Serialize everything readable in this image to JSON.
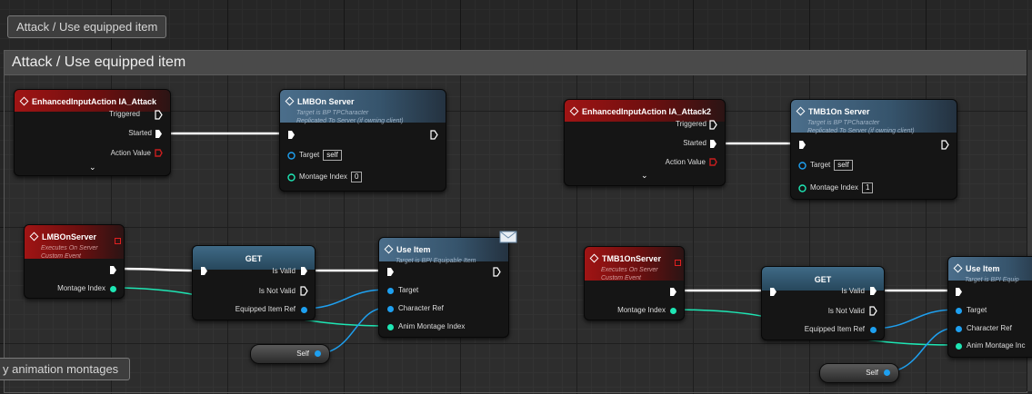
{
  "comment": {
    "tag_label": "Attack / Use equipped item",
    "title": "Attack / Use equipped item",
    "lower_tag_label": "y animation montages"
  },
  "nodes": {
    "ia_attack": {
      "title": "EnhancedInputAction IA_Attack",
      "pins": [
        "Triggered",
        "Started",
        "Action Value"
      ]
    },
    "lmb_on_server_call": {
      "title": "LMBOn Server",
      "sub1": "Target is BP TPCharacter",
      "sub2": "Replicated To Server (if owning client)",
      "target_label": "Target",
      "target_default": "self",
      "montage_label": "Montage Index",
      "montage_default": "0"
    },
    "ia_attack2": {
      "title": "EnhancedInputAction IA_Attack2",
      "pins": [
        "Triggered",
        "Started",
        "Action Value"
      ]
    },
    "tmb1_on_server_call": {
      "title": "TMB1On Server",
      "sub1": "Target is BP TPCharacter",
      "sub2": "Replicated To Server (if owning client)",
      "target_label": "Target",
      "target_default": "self",
      "montage_label": "Montage Index",
      "montage_default": "1"
    },
    "lmb_on_server_event": {
      "title": "LMBOnServer",
      "sub1": "Executes On Server",
      "sub2": "Custom Event",
      "pin": "Montage Index"
    },
    "get1": {
      "title": "GET",
      "pins": [
        "Is Valid",
        "Is Not Valid",
        "Equipped Item Ref"
      ]
    },
    "use_item1": {
      "title": "Use Item",
      "sub1": "Target is BPI Equipable Item",
      "pins": [
        "Target",
        "Character Ref",
        "Anim Montage Index"
      ]
    },
    "self1": {
      "label": "Self"
    },
    "tmb1_on_server_event": {
      "title": "TMB1OnServer",
      "sub1": "Executes On Server",
      "sub2": "Custom Event",
      "pin": "Montage Index"
    },
    "get2": {
      "title": "GET",
      "pins": [
        "Is Valid",
        "Is Not Valid",
        "Equipped Item Ref"
      ]
    },
    "use_item2": {
      "title": "Use Item",
      "sub1": "Target is BPI Equip",
      "pins": [
        "Target",
        "Character Ref",
        "Anim Montage Inc"
      ]
    },
    "self2": {
      "label": "Self"
    }
  },
  "colors": {
    "event_header": "#a01414",
    "function_header": "#4b6e8b",
    "object_pin": "#1ea0f0",
    "integer_pin": "#1ee6b4",
    "exec_wire": "#ffffff",
    "action_value_pin": "#c81e1e"
  }
}
